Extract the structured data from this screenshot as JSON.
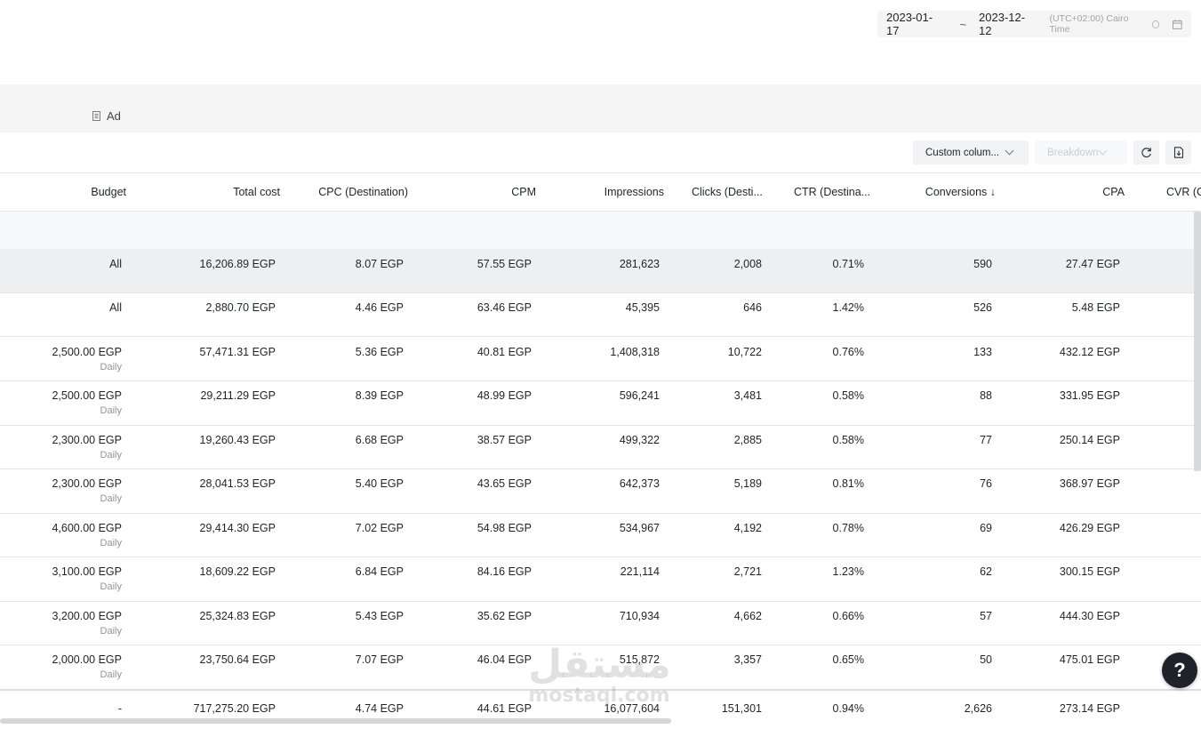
{
  "date_range": {
    "start": "2023-01-17",
    "separator": "~",
    "end": "2023-12-12",
    "timezone": "(UTC+02:00) Cairo Time"
  },
  "level_bar": {
    "ad_label": "Ad"
  },
  "toolbar": {
    "custom_columns_label": "Custom colum...",
    "breakdown_label": "Breakdown"
  },
  "columns": [
    "Budget",
    "Total cost",
    "CPC (Destination)",
    "CPM",
    "Impressions",
    "Clicks (Desti...",
    "CTR (Destina...",
    "Conversions ↓",
    "CPA",
    "CVR (C"
  ],
  "summary_rows": [
    {
      "budget": "All",
      "total_cost": "16,206.89 EGP",
      "cpc": "8.07 EGP",
      "cpm": "57.55 EGP",
      "impressions": "281,623",
      "clicks": "2,008",
      "ctr": "0.71%",
      "conversions": "590",
      "cpa": "27.47 EGP"
    },
    {
      "budget": "All",
      "total_cost": "2,880.70 EGP",
      "cpc": "4.46 EGP",
      "cpm": "63.46 EGP",
      "impressions": "45,395",
      "clicks": "646",
      "ctr": "1.42%",
      "conversions": "526",
      "cpa": "5.48 EGP"
    }
  ],
  "rows": [
    {
      "budget": "2,500.00 EGP",
      "budget_type": "Daily",
      "total_cost": "57,471.31 EGP",
      "cpc": "5.36 EGP",
      "cpm": "40.81 EGP",
      "impressions": "1,408,318",
      "clicks": "10,722",
      "ctr": "0.76%",
      "conversions": "133",
      "cpa": "432.12 EGP"
    },
    {
      "budget": "2,500.00 EGP",
      "budget_type": "Daily",
      "total_cost": "29,211.29 EGP",
      "cpc": "8.39 EGP",
      "cpm": "48.99 EGP",
      "impressions": "596,241",
      "clicks": "3,481",
      "ctr": "0.58%",
      "conversions": "88",
      "cpa": "331.95 EGP"
    },
    {
      "budget": "2,300.00 EGP",
      "budget_type": "Daily",
      "total_cost": "19,260.43 EGP",
      "cpc": "6.68 EGP",
      "cpm": "38.57 EGP",
      "impressions": "499,322",
      "clicks": "2,885",
      "ctr": "0.58%",
      "conversions": "77",
      "cpa": "250.14 EGP"
    },
    {
      "budget": "2,300.00 EGP",
      "budget_type": "Daily",
      "total_cost": "28,041.53 EGP",
      "cpc": "5.40 EGP",
      "cpm": "43.65 EGP",
      "impressions": "642,373",
      "clicks": "5,189",
      "ctr": "0.81%",
      "conversions": "76",
      "cpa": "368.97 EGP"
    },
    {
      "budget": "4,600.00 EGP",
      "budget_type": "Daily",
      "total_cost": "29,414.30 EGP",
      "cpc": "7.02 EGP",
      "cpm": "54.98 EGP",
      "impressions": "534,967",
      "clicks": "4,192",
      "ctr": "0.78%",
      "conversions": "69",
      "cpa": "426.29 EGP"
    },
    {
      "budget": "3,100.00 EGP",
      "budget_type": "Daily",
      "total_cost": "18,609.22 EGP",
      "cpc": "6.84 EGP",
      "cpm": "84.16 EGP",
      "impressions": "221,114",
      "clicks": "2,721",
      "ctr": "1.23%",
      "conversions": "62",
      "cpa": "300.15 EGP"
    },
    {
      "budget": "3,200.00 EGP",
      "budget_type": "Daily",
      "total_cost": "25,324.83 EGP",
      "cpc": "5.43 EGP",
      "cpm": "35.62 EGP",
      "impressions": "710,934",
      "clicks": "4,662",
      "ctr": "0.66%",
      "conversions": "57",
      "cpa": "444.30 EGP"
    },
    {
      "budget": "2,000.00 EGP",
      "budget_type": "Daily",
      "total_cost": "23,750.64 EGP",
      "cpc": "7.07 EGP",
      "cpm": "46.04 EGP",
      "impressions": "515,872",
      "clicks": "3,357",
      "ctr": "0.65%",
      "conversions": "50",
      "cpa": "475.01 EGP"
    }
  ],
  "totals": {
    "budget": "-",
    "total_cost": "717,275.20 EGP",
    "cpc": "4.74 EGP",
    "cpm": "44.61 EGP",
    "impressions": "16,077,604",
    "clicks": "151,301",
    "ctr": "0.94%",
    "conversions": "2,626",
    "cpa": "273.14 EGP"
  },
  "help_button": "?",
  "watermark": {
    "arabic": "مستقل",
    "latin": "mostaql.com"
  }
}
